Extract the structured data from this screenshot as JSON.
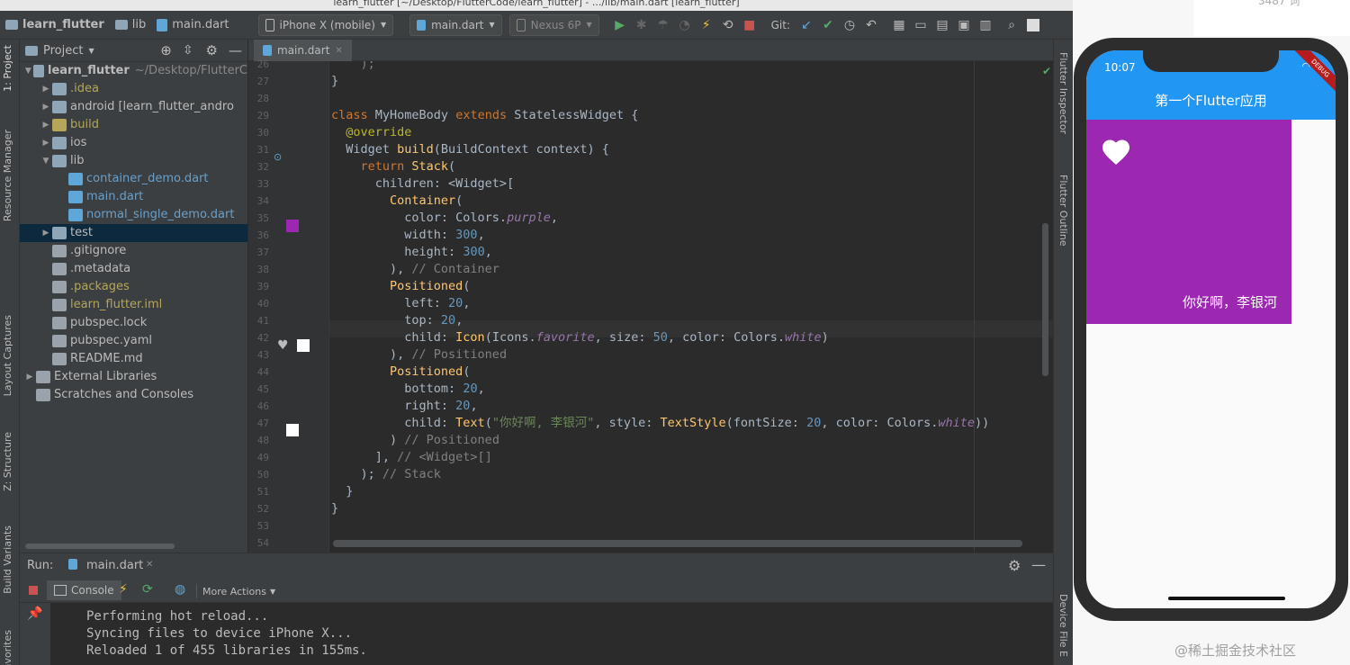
{
  "window": {
    "title": "learn_flutter [~/Desktop/FlutterCode/learn_flutter] - .../lib/main.dart [learn_flutter]"
  },
  "toolbar": {
    "breadcrumb": [
      "learn_flutter",
      "lib",
      "main.dart"
    ],
    "device": "iPhone X (mobile)",
    "run_config": "main.dart",
    "emulator": "Nexus 6P",
    "git_label": "Git:"
  },
  "left_tabs": [
    "1: Project",
    "Resource Manager",
    "Layout Captures",
    "Z: Structure",
    "Build Variants",
    "avorites"
  ],
  "right_tabs": [
    "Flutter Inspector",
    "Flutter Outline",
    "Device File E"
  ],
  "project_panel": {
    "title": "Project",
    "tree": [
      {
        "label": "learn_flutter",
        "suffix": "~/Desktop/FlutterC",
        "indent": 0,
        "arrow": "▼",
        "icon": "folder",
        "color": "#bbbbbb",
        "bold": true
      },
      {
        "label": ".idea",
        "suffix": "",
        "indent": 1,
        "arrow": "▶",
        "icon": "folder",
        "color": "#b5a65a"
      },
      {
        "label": "android [learn_flutter_andro",
        "suffix": "",
        "indent": 1,
        "arrow": "▶",
        "icon": "folder",
        "color": "#bbbbbb"
      },
      {
        "label": "build",
        "suffix": "",
        "indent": 1,
        "arrow": "▶",
        "icon": "folder-y",
        "color": "#b5a65a"
      },
      {
        "label": "ios",
        "suffix": "",
        "indent": 1,
        "arrow": "▶",
        "icon": "folder",
        "color": "#bbbbbb"
      },
      {
        "label": "lib",
        "suffix": "",
        "indent": 1,
        "arrow": "▼",
        "icon": "folder",
        "color": "#bbbbbb"
      },
      {
        "label": "container_demo.dart",
        "suffix": "",
        "indent": 2,
        "arrow": "",
        "icon": "dart",
        "color": "#6a9fc9"
      },
      {
        "label": "main.dart",
        "suffix": "",
        "indent": 2,
        "arrow": "",
        "icon": "dart",
        "color": "#6a9fc9"
      },
      {
        "label": "normal_single_demo.dart",
        "suffix": "",
        "indent": 2,
        "arrow": "",
        "icon": "dart",
        "color": "#6a9fc9"
      },
      {
        "label": "test",
        "suffix": "",
        "indent": 1,
        "arrow": "▶",
        "icon": "folder",
        "color": "#bbbbbb",
        "selected": true
      },
      {
        "label": ".gitignore",
        "suffix": "",
        "indent": 1,
        "arrow": "",
        "icon": "file",
        "color": "#bbbbbb"
      },
      {
        "label": ".metadata",
        "suffix": "",
        "indent": 1,
        "arrow": "",
        "icon": "file",
        "color": "#bbbbbb"
      },
      {
        "label": ".packages",
        "suffix": "",
        "indent": 1,
        "arrow": "",
        "icon": "file",
        "color": "#b5a65a"
      },
      {
        "label": "learn_flutter.iml",
        "suffix": "",
        "indent": 1,
        "arrow": "",
        "icon": "file",
        "color": "#b5a65a"
      },
      {
        "label": "pubspec.lock",
        "suffix": "",
        "indent": 1,
        "arrow": "",
        "icon": "file",
        "color": "#bbbbbb"
      },
      {
        "label": "pubspec.yaml",
        "suffix": "",
        "indent": 1,
        "arrow": "",
        "icon": "file",
        "color": "#bbbbbb"
      },
      {
        "label": "README.md",
        "suffix": "",
        "indent": 1,
        "arrow": "",
        "icon": "file",
        "color": "#bbbbbb"
      },
      {
        "label": "External Libraries",
        "suffix": "",
        "indent": 0,
        "arrow": "▶",
        "icon": "lib",
        "color": "#bbbbbb"
      },
      {
        "label": "Scratches and Consoles",
        "suffix": "",
        "indent": 0,
        "arrow": "",
        "icon": "scratch",
        "color": "#bbbbbb"
      }
    ]
  },
  "editor": {
    "tab": "main.dart",
    "lines": [
      {
        "n": "26",
        "t": [
          [
            "cm",
            "    );"
          ]
        ]
      },
      {
        "n": "27",
        "t": [
          [
            "plain",
            "}"
          ]
        ]
      },
      {
        "n": "28",
        "t": []
      },
      {
        "n": "29",
        "t": [
          [
            "k",
            "class "
          ],
          [
            "plain",
            "MyHomeBody "
          ],
          [
            "k",
            "extends "
          ],
          [
            "plain",
            "StatelessWidget {"
          ]
        ]
      },
      {
        "n": "30",
        "t": [
          [
            "ann",
            "  @override"
          ]
        ]
      },
      {
        "n": "31",
        "t": [
          [
            "plain",
            "  Widget "
          ],
          [
            "fn",
            "build"
          ],
          [
            "plain",
            "(BuildContext context) {"
          ]
        ]
      },
      {
        "n": "32",
        "t": [
          [
            "k",
            "    return "
          ],
          [
            "fn",
            "Stack"
          ],
          [
            "plain",
            "("
          ]
        ]
      },
      {
        "n": "33",
        "t": [
          [
            "plain",
            "      children: <Widget>["
          ]
        ]
      },
      {
        "n": "34",
        "t": [
          [
            "fn",
            "        Container"
          ],
          [
            "plain",
            "("
          ]
        ]
      },
      {
        "n": "35",
        "t": [
          [
            "plain",
            "          color: Colors."
          ],
          [
            "it",
            "purple"
          ],
          [
            "plain",
            ","
          ]
        ]
      },
      {
        "n": "36",
        "t": [
          [
            "plain",
            "          width: "
          ],
          [
            "num",
            "300"
          ],
          [
            "plain",
            ","
          ]
        ]
      },
      {
        "n": "37",
        "t": [
          [
            "plain",
            "          height: "
          ],
          [
            "num",
            "300"
          ],
          [
            "plain",
            ","
          ]
        ]
      },
      {
        "n": "38",
        "t": [
          [
            "plain",
            "        ), "
          ],
          [
            "cm",
            "// Container"
          ]
        ]
      },
      {
        "n": "39",
        "t": [
          [
            "fn",
            "        Positioned"
          ],
          [
            "plain",
            "("
          ]
        ]
      },
      {
        "n": "40",
        "t": [
          [
            "plain",
            "          left: "
          ],
          [
            "num",
            "20"
          ],
          [
            "plain",
            ","
          ]
        ]
      },
      {
        "n": "41",
        "t": [
          [
            "plain",
            "          top: "
          ],
          [
            "num",
            "20"
          ],
          [
            "plain",
            ","
          ]
        ]
      },
      {
        "n": "42",
        "t": [
          [
            "plain",
            "          child: "
          ],
          [
            "fn",
            "Icon"
          ],
          [
            "plain",
            "(Icons."
          ],
          [
            "it",
            "favorite"
          ],
          [
            "plain",
            ", size: "
          ],
          [
            "num",
            "50"
          ],
          [
            "plain",
            ", color: Colors."
          ],
          [
            "it",
            "white"
          ],
          [
            "plain",
            ")"
          ]
        ]
      },
      {
        "n": "43",
        "t": [
          [
            "plain",
            "        ), "
          ],
          [
            "cm",
            "// Positioned"
          ]
        ]
      },
      {
        "n": "44",
        "t": [
          [
            "fn",
            "        Positioned"
          ],
          [
            "plain",
            "("
          ]
        ]
      },
      {
        "n": "45",
        "t": [
          [
            "plain",
            "          bottom: "
          ],
          [
            "num",
            "20"
          ],
          [
            "plain",
            ","
          ]
        ]
      },
      {
        "n": "46",
        "t": [
          [
            "plain",
            "          right: "
          ],
          [
            "num",
            "20"
          ],
          [
            "plain",
            ","
          ]
        ]
      },
      {
        "n": "47",
        "t": [
          [
            "plain",
            "          child: "
          ],
          [
            "fn",
            "Text"
          ],
          [
            "plain",
            "("
          ],
          [
            "str",
            "\"你好啊, 李银河\""
          ],
          [
            "plain",
            ", style: "
          ],
          [
            "fn",
            "TextStyle"
          ],
          [
            "plain",
            "(fontSize: "
          ],
          [
            "num",
            "20"
          ],
          [
            "plain",
            ", color: Colors."
          ],
          [
            "it",
            "white"
          ],
          [
            "plain",
            "))"
          ]
        ]
      },
      {
        "n": "48",
        "t": [
          [
            "plain",
            "        ) "
          ],
          [
            "cm",
            "// Positioned"
          ]
        ]
      },
      {
        "n": "49",
        "t": [
          [
            "plain",
            "      ], "
          ],
          [
            "cm",
            "// <Widget>[]"
          ]
        ]
      },
      {
        "n": "50",
        "t": [
          [
            "plain",
            "    ); "
          ],
          [
            "cm",
            "// Stack"
          ]
        ]
      },
      {
        "n": "51",
        "t": [
          [
            "plain",
            "  }"
          ]
        ]
      },
      {
        "n": "52",
        "t": [
          [
            "plain",
            "}"
          ]
        ]
      },
      {
        "n": "53",
        "t": []
      },
      {
        "n": "54",
        "t": []
      }
    ]
  },
  "run": {
    "label": "Run:",
    "tab": "main.dart",
    "console_tab": "Console",
    "more_actions": "More Actions",
    "output": [
      "Performing hot reload...",
      "Syncing files to device iPhone X...",
      "Reloaded 1 of 455 libraries in 155ms."
    ]
  },
  "phone": {
    "time": "10:07",
    "banner": "DEBUG",
    "app_title": "第一个Flutter应用",
    "positioned_text": "你好啊，李银河",
    "container_color": "#9c27b0",
    "appbar_color": "#2196f3"
  },
  "top_right_text": "3487 词",
  "watermark": "@稀土掘金技术社区"
}
